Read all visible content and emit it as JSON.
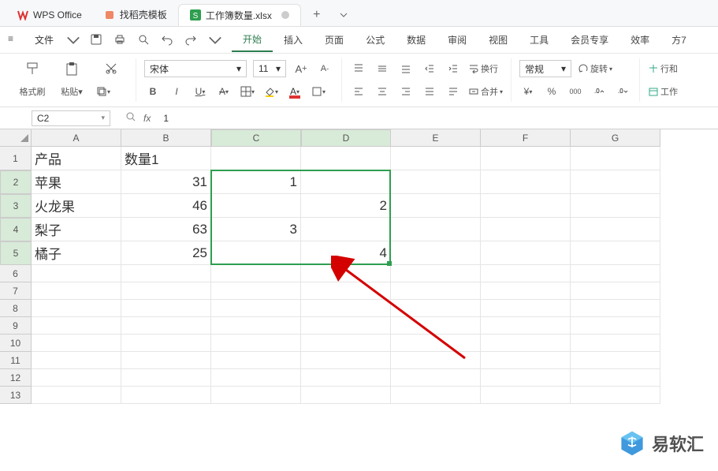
{
  "tabs": {
    "app": "WPS Office",
    "templates": "找稻壳模板",
    "file": "工作簿数量.xlsx",
    "add": "+"
  },
  "file_menu": "文件",
  "menu": [
    "开始",
    "插入",
    "页面",
    "公式",
    "数据",
    "审阅",
    "视图",
    "工具",
    "会员专享",
    "效率",
    "方7"
  ],
  "active_menu": 0,
  "ribbon": {
    "fmt_painter": "格式刷",
    "paste": "粘贴",
    "font_name": "宋体",
    "font_size": "11",
    "wrap": "换行",
    "merge": "合并",
    "number_fmt": "常规",
    "rotate": "旋转",
    "rowcol": "行和",
    "worksheet": "工作"
  },
  "namebox": "C2",
  "formula": "1",
  "columns": [
    "A",
    "B",
    "C",
    "D",
    "E",
    "F",
    "G"
  ],
  "rows": [
    "1",
    "2",
    "3",
    "4",
    "5",
    "6",
    "7",
    "8",
    "9",
    "10",
    "11",
    "12",
    "13"
  ],
  "chart_data": {
    "type": "table",
    "headers": [
      "产品",
      "数量1"
    ],
    "rows": [
      {
        "A": "苹果",
        "B": 31,
        "C": 1,
        "D": ""
      },
      {
        "A": "火龙果",
        "B": 46,
        "C": "",
        "D": 2
      },
      {
        "A": "梨子",
        "B": 63,
        "C": 3,
        "D": ""
      },
      {
        "A": "橘子",
        "B": 25,
        "C": "",
        "D": 4
      }
    ]
  },
  "watermark": "易软汇",
  "icons": {
    "w": "W",
    "shell": "◆",
    "sheet": "S",
    "menu": "≡",
    "save": "▢",
    "print": "⎙",
    "preview": "▤",
    "undo": "↶",
    "redo": "↷",
    "zoom": "⌕",
    "fx": "fx"
  },
  "colors": {
    "accent": "#2e9e4f",
    "arrow": "#d40000"
  }
}
